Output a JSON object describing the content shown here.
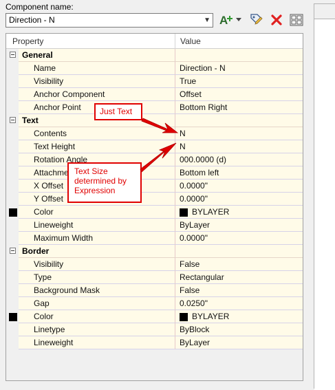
{
  "component": {
    "label": "Component name:",
    "value": "Direction - N"
  },
  "toolbar": {
    "add_icon": "add-component-icon",
    "edit_icon": "edit-tag-icon",
    "delete_icon": "delete-x-icon",
    "grid_icon": "component-grid-icon"
  },
  "grid": {
    "col_property": "Property",
    "col_value": "Value",
    "general": {
      "title": "General",
      "name_label": "Name",
      "name_value": "Direction - N",
      "visibility_label": "Visibility",
      "visibility_value": "True",
      "anchor_component_label": "Anchor Component",
      "anchor_component_value": "Offset",
      "anchor_point_label": "Anchor Point",
      "anchor_point_value": "Bottom Right"
    },
    "text": {
      "title": "Text",
      "contents_label": "Contents",
      "contents_value": "N",
      "text_height_label": "Text Height",
      "text_height_value": "N",
      "rotation_label": "Rotation Angle",
      "rotation_value": "000.0000 (d)",
      "attachment_label": "Attachment",
      "attachment_value": "Bottom left",
      "x_offset_label": "X Offset",
      "x_offset_value": "0.0000\"",
      "y_offset_label": "Y Offset",
      "y_offset_value": "0.0000\"",
      "color_label": "Color",
      "color_value": "BYLAYER",
      "lineweight_label": "Lineweight",
      "lineweight_value": "ByLayer",
      "max_width_label": "Maximum Width",
      "max_width_value": "0.0000\""
    },
    "border": {
      "title": "Border",
      "visibility_label": "Visibility",
      "visibility_value": "False",
      "type_label": "Type",
      "type_value": "Rectangular",
      "bg_mask_label": "Background Mask",
      "bg_mask_value": "False",
      "gap_label": "Gap",
      "gap_value": "0.0250\"",
      "color_label": "Color",
      "color_value": "BYLAYER",
      "linetype_label": "Linetype",
      "linetype_value": "ByBlock",
      "lineweight_label": "Lineweight",
      "lineweight_value": "ByLayer"
    }
  },
  "annotations": {
    "just_text": "Just Text",
    "text_size": "Text Size determined by Expression",
    "color": "#e00000"
  }
}
